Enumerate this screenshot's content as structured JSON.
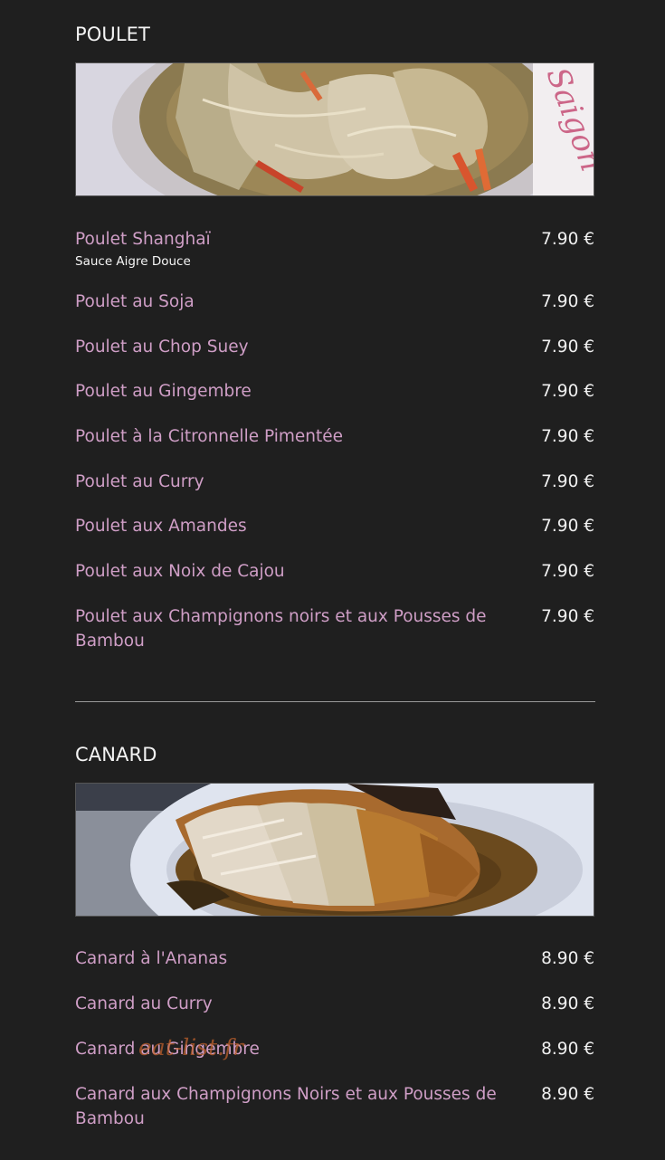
{
  "sections": [
    {
      "title": "POULET",
      "photo_caption": "Saigon",
      "items": [
        {
          "name": "Poulet Shanghaï",
          "desc": "Sauce Aigre Douce",
          "price": "7.90 €"
        },
        {
          "name": "Poulet au Soja",
          "price": "7.90 €"
        },
        {
          "name": "Poulet au Chop Suey",
          "price": "7.90 €"
        },
        {
          "name": "Poulet au Gingembre",
          "price": "7.90 €"
        },
        {
          "name": "Poulet à la Citronnelle Pimentée",
          "price": "7.90 €"
        },
        {
          "name": "Poulet au Curry",
          "price": "7.90 €"
        },
        {
          "name": "Poulet aux Amandes",
          "price": "7.90 €"
        },
        {
          "name": "Poulet aux Noix de Cajou",
          "price": "7.90 €"
        },
        {
          "name": "Poulet aux Champignons noirs et aux Pousses de Bambou",
          "price": "7.90 €"
        }
      ]
    },
    {
      "title": "CANARD",
      "items": [
        {
          "name": "Canard à l'Ananas",
          "price": "8.90 €"
        },
        {
          "name": "Canard au Curry",
          "price": "8.90 €"
        },
        {
          "name": "Canard au Gingembre",
          "price": "8.90 €"
        },
        {
          "name": "Canard aux Champignons Noirs et aux Pousses de Bambou",
          "price": "8.90 €"
        }
      ]
    }
  ],
  "watermark": "eat-list.fr",
  "colors": {
    "background": "#1f1f1f",
    "item_name": "#cf9ec6",
    "price": "#f0f0f0",
    "divider": "#9a9a9a",
    "watermark": "#c4622c"
  }
}
